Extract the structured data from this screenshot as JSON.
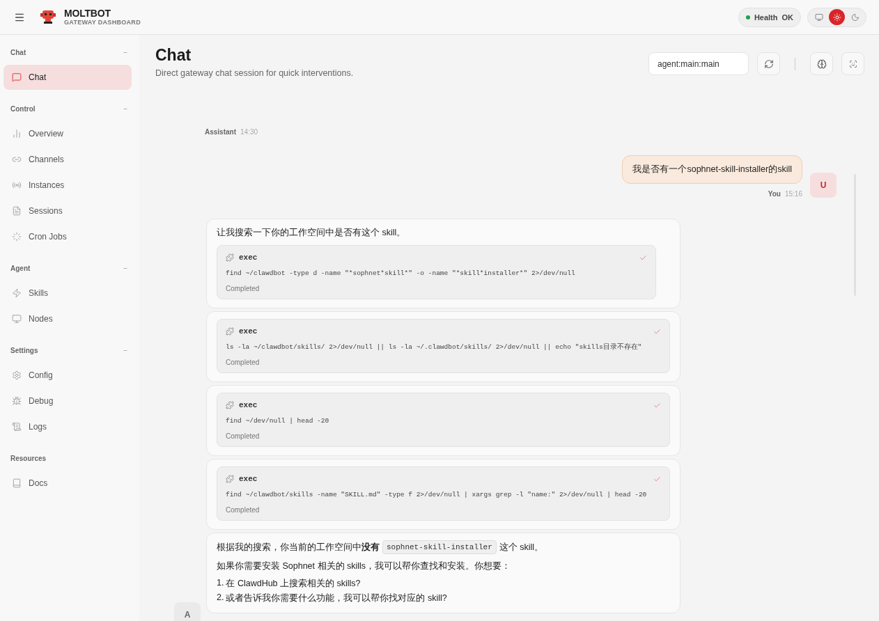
{
  "header": {
    "brand": "MOLTBOT",
    "subtitle": "GATEWAY DASHBOARD",
    "health": {
      "label": "Health",
      "value": "OK",
      "color": "#22a04a"
    },
    "theme_options": [
      {
        "kind": "system",
        "selected": false
      },
      {
        "kind": "light",
        "selected": true
      },
      {
        "kind": "dark",
        "selected": false
      }
    ]
  },
  "sidebar": {
    "groups": [
      {
        "label": "Chat",
        "collapse": "−",
        "items": [
          {
            "label": "Chat",
            "selected": true
          }
        ]
      },
      {
        "label": "Control",
        "collapse": "−",
        "items": [
          {
            "label": "Overview",
            "selected": false
          },
          {
            "label": "Channels",
            "selected": false
          },
          {
            "label": "Instances",
            "selected": false
          },
          {
            "label": "Sessions",
            "selected": false
          },
          {
            "label": "Cron Jobs",
            "selected": false
          }
        ]
      },
      {
        "label": "Agent",
        "collapse": "−",
        "items": [
          {
            "label": "Skills",
            "selected": false
          },
          {
            "label": "Nodes",
            "selected": false
          }
        ]
      },
      {
        "label": "Settings",
        "collapse": "−",
        "items": [
          {
            "label": "Config",
            "selected": false
          },
          {
            "label": "Debug",
            "selected": false
          },
          {
            "label": "Logs",
            "selected": false
          }
        ]
      },
      {
        "label": "Resources",
        "items": [
          {
            "label": "Docs",
            "selected": false
          }
        ]
      }
    ]
  },
  "page": {
    "title": "Chat",
    "subtitle": "Direct gateway chat session for quick interventions.",
    "session": "agent:main:main"
  },
  "chat": {
    "previous_meta": {
      "sender": "Assistant",
      "time": "14:30"
    },
    "user_message": {
      "text": "我是否有一个sophnet-skill-installer的skill",
      "sender": "You",
      "time": "15:16",
      "avatar": "U"
    },
    "assistant": {
      "avatar": "A",
      "bubbles": [
        {
          "text": "让我搜索一下你的工作空间中是否有这个 skill。",
          "tool": {
            "name": "exec",
            "command": "find ~/clawdbot -type d -name \"*sophnet*skill*\" -o -name \"*skill*installer*\" 2>/dev/null",
            "status": "Completed",
            "done": true
          }
        },
        {
          "tool": {
            "name": "exec",
            "command": "ls -la ~/clawdbot/skills/ 2>/dev/null || ls -la ~/.clawdbot/skills/ 2>/dev/null || echo \"skills目录不存在\"",
            "status": "Completed",
            "done": true
          }
        },
        {
          "tool": {
            "name": "exec",
            "command": "find ~/dev/null | head -20",
            "status": "Completed",
            "done": true
          }
        },
        {
          "tool": {
            "name": "exec",
            "command": "find ~/clawdbot/skills -name \"SKILL.md\" -type f 2>/dev/null | xargs grep -l \"name:\" 2>/dev/null | head -20",
            "status": "Completed",
            "done": true
          }
        }
      ],
      "answer": {
        "lead": "根据我的搜索，你当前的工作空间中**没有**",
        "code": "sophnet-skill-installer",
        "trail": "这个 skill。",
        "paragraph": "如果你需要安装 Sophnet 相关的 skills，我可以帮你查找和安装。你想要：",
        "list": [
          {
            "marker": "1.",
            "text": "在 ClawdHub 上搜索相关的 skills?"
          },
          {
            "marker": "2.",
            "text": "或者告诉我你需要什么功能，我可以帮你找对应的 skill?"
          }
        ]
      }
    }
  }
}
